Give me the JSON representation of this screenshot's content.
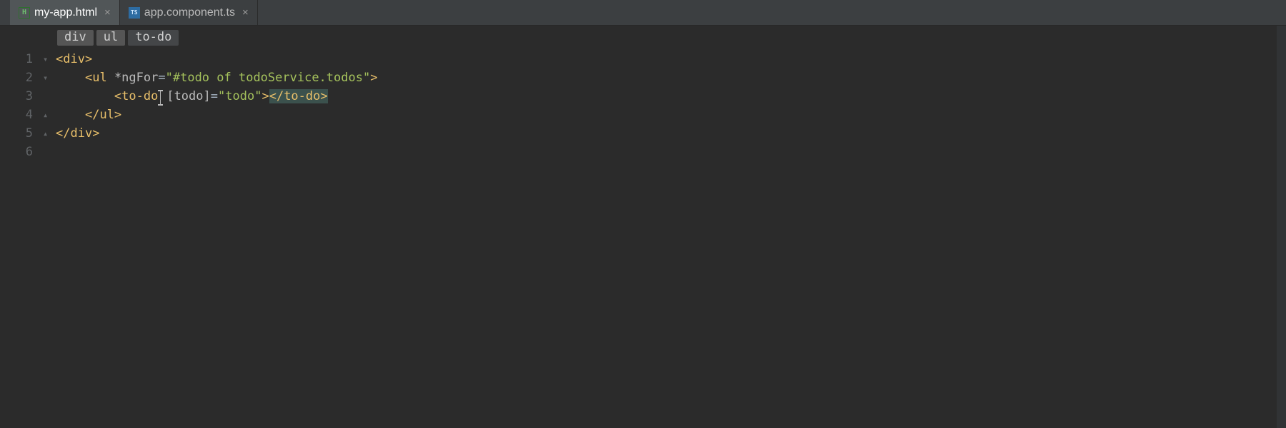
{
  "tabs": [
    {
      "label": "my-app.html",
      "icon": "html",
      "active": true
    },
    {
      "label": "app.component.ts",
      "icon": "ts",
      "active": false
    }
  ],
  "breadcrumbs": [
    "div",
    "ul",
    "to-do"
  ],
  "gutter_lines": [
    "1",
    "2",
    "3",
    "4",
    "5",
    "6"
  ],
  "fold_lines": [
    "▾",
    "▾",
    "",
    "▴",
    "▴",
    ""
  ],
  "code": {
    "l1": {
      "open": "<",
      "tag": "div",
      "close": ">"
    },
    "l2": {
      "open": "<",
      "tag": "ul",
      "sp": " ",
      "attr": "*ngFor",
      "eq": "=",
      "q1": "\"",
      "val": "#todo of todoService.todos",
      "q2": "\"",
      "close": ">"
    },
    "l3": {
      "open1": "<",
      "tag1": "to-do",
      "sp": " ",
      "attr": "[todo]",
      "eq": "=",
      "q1": "\"",
      "val": "todo",
      "q2": "\"",
      "close1": ">",
      "open2": "</",
      "tag2": "to-do",
      "close2": ">"
    },
    "l4": {
      "open": "</",
      "tag": "ul",
      "close": ">"
    },
    "l5": {
      "open": "</",
      "tag": "div",
      "close": ">"
    }
  }
}
